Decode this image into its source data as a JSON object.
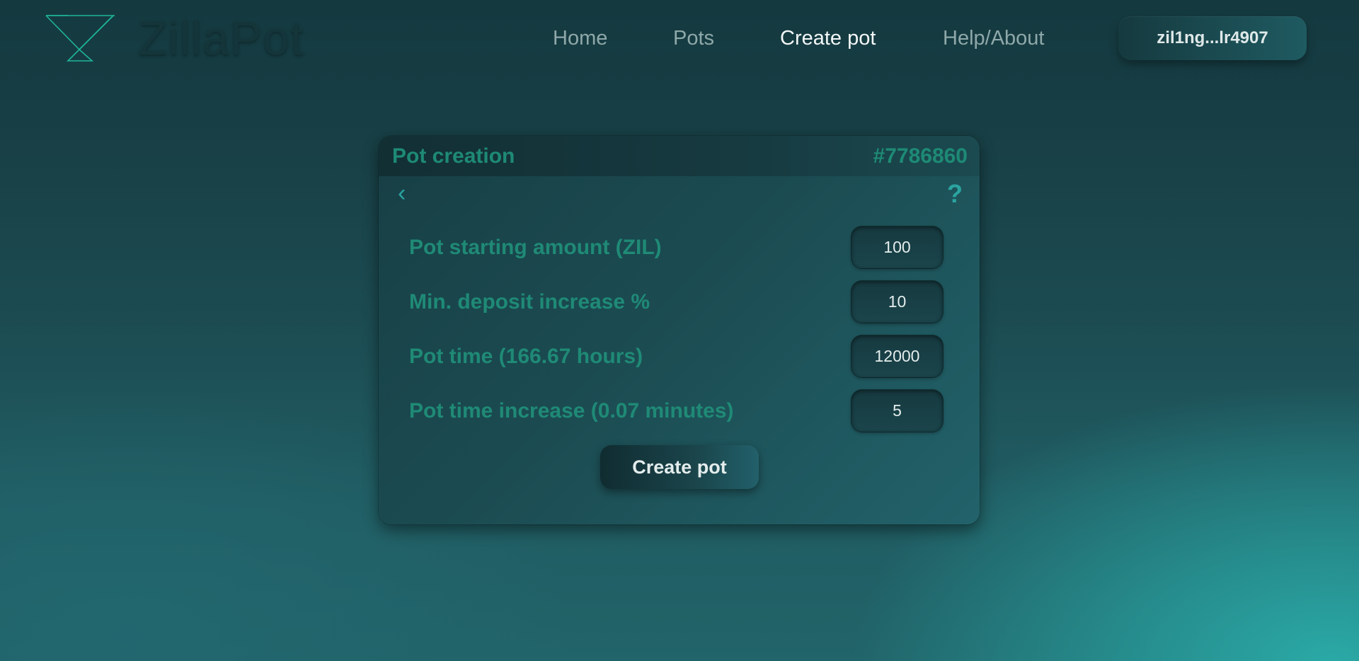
{
  "brand": {
    "name": "ZillaPot",
    "accent": "#1fb596"
  },
  "nav": {
    "items": [
      {
        "label": "Home",
        "active": false
      },
      {
        "label": "Pots",
        "active": false
      },
      {
        "label": "Create pot",
        "active": true
      },
      {
        "label": "Help/About",
        "active": false
      }
    ]
  },
  "wallet": {
    "address": "zil1ng...lr4907"
  },
  "card": {
    "title": "Pot creation",
    "id": "#7786860",
    "back_icon": "chevron-left-icon",
    "help_icon": "question-mark-icon",
    "help_label": "?",
    "back_label": "‹",
    "fields": [
      {
        "label": "Pot starting amount (ZIL)",
        "value": "100"
      },
      {
        "label": "Min. deposit increase %",
        "value": "10"
      },
      {
        "label": "Pot time (166.67 hours)",
        "value": "12000"
      },
      {
        "label": "Pot time increase (0.07 minutes)",
        "value": "5"
      }
    ],
    "submit_label": "Create pot"
  },
  "colors": {
    "label": "#1f8a76",
    "icon": "#2aa4a0",
    "nav_inactive": "#8fa8a9",
    "nav_active": "#f3f7f7"
  }
}
